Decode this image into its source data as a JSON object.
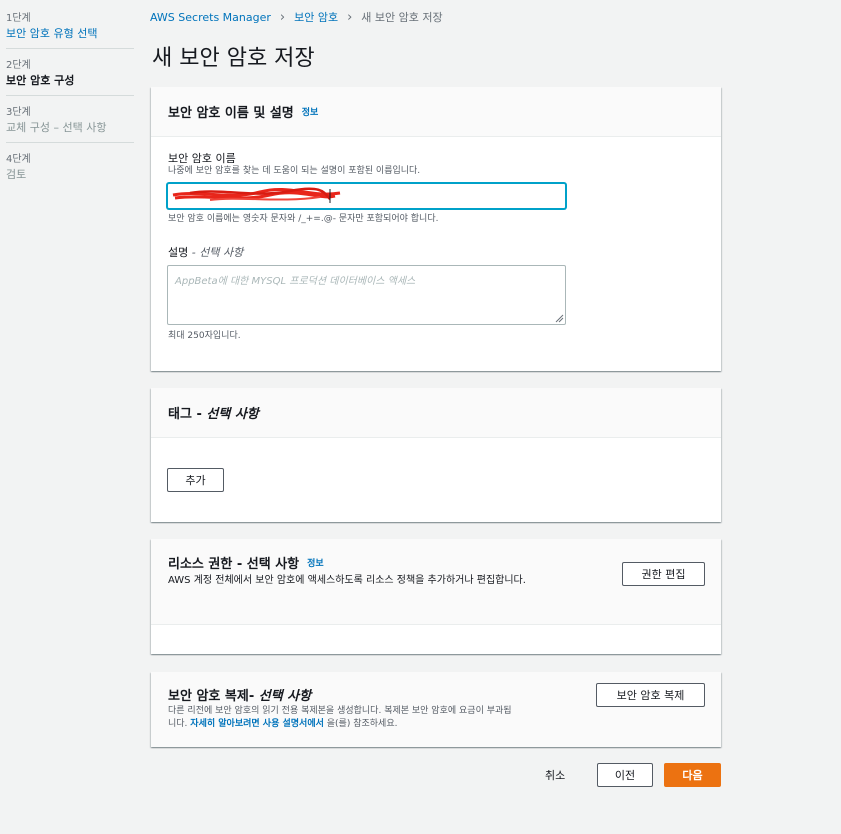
{
  "steps": [
    {
      "num": "1단계",
      "label": "보안 암호 유형 선택"
    },
    {
      "num": "2단계",
      "label": "보안 암호 구성"
    },
    {
      "num": "3단계",
      "label": "교체 구성 – 선택 사항"
    },
    {
      "num": "4단계",
      "label": "검토"
    }
  ],
  "breadcrumb": {
    "root": "AWS Secrets Manager",
    "parent": "보안 암호",
    "current": "새 보안 암호 저장"
  },
  "page_title": "새 보안 암호 저장",
  "name_panel": {
    "title": "보안 암호 이름 및 설명",
    "info": "정보",
    "name_label": "보안 암호 이름",
    "name_desc": "나중에 보안 암호를 찾는 데 도움이 되는 설명이 포함된 이름입니다.",
    "name_constraint": "보안 암호 이름에는 영숫자 문자와 /_+=.@- 문자만 포함되어야 합니다.",
    "desc_label": "설명",
    "desc_optional": "선택 사항",
    "desc_placeholder": "AppBeta에 대한 MYSQL 프로덕션 데이터베이스 액세스",
    "desc_limit": "최대 250자입니다."
  },
  "tags_panel": {
    "title": "태그",
    "optional": "선택 사항",
    "add_button": "추가"
  },
  "resource_panel": {
    "title": "리소스 권한 - 선택 사항",
    "info": "정보",
    "description": "AWS 계정 전체에서 보안 암호에 액세스하도록 리소스 정책을 추가하거나 편집합니다.",
    "edit_button": "권한 편집"
  },
  "replica_panel": {
    "title": "보안 암호 복제",
    "optional": "선택 사항",
    "description_prefix": "다른 리전에 보안 암호의 읽기 전용 복제본을 생성합니다. 복제본 보안 암호에 요금이 부과됩니다. ",
    "link": "자세히 알아보려면 사용 설명서에서",
    "description_suffix": " 을(를) 참조하세요.",
    "button": "보안 암호 복제"
  },
  "footer": {
    "cancel": "취소",
    "previous": "이전",
    "next": "다음"
  },
  "colors": {
    "link": "#0073bb",
    "primary": "#ec7211",
    "focus": "#00a1c9",
    "background": "#f2f3f3"
  }
}
